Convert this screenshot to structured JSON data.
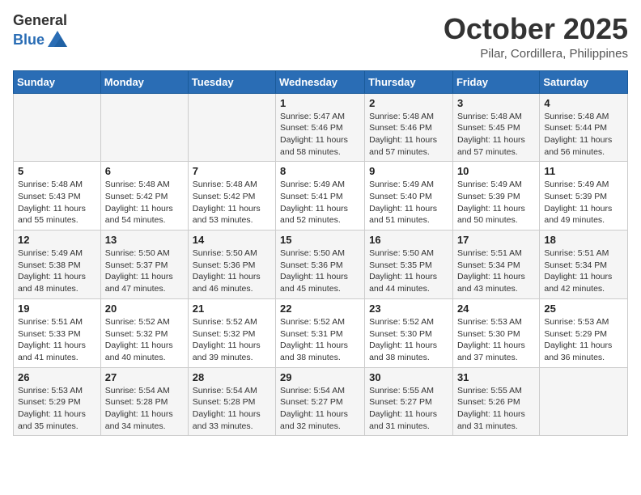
{
  "header": {
    "logo_general": "General",
    "logo_blue": "Blue",
    "month_title": "October 2025",
    "location": "Pilar, Cordillera, Philippines"
  },
  "weekdays": [
    "Sunday",
    "Monday",
    "Tuesday",
    "Wednesday",
    "Thursday",
    "Friday",
    "Saturday"
  ],
  "weeks": [
    [
      {
        "day": "",
        "info": ""
      },
      {
        "day": "",
        "info": ""
      },
      {
        "day": "",
        "info": ""
      },
      {
        "day": "1",
        "info": "Sunrise: 5:47 AM\nSunset: 5:46 PM\nDaylight: 11 hours\nand 58 minutes."
      },
      {
        "day": "2",
        "info": "Sunrise: 5:48 AM\nSunset: 5:46 PM\nDaylight: 11 hours\nand 57 minutes."
      },
      {
        "day": "3",
        "info": "Sunrise: 5:48 AM\nSunset: 5:45 PM\nDaylight: 11 hours\nand 57 minutes."
      },
      {
        "day": "4",
        "info": "Sunrise: 5:48 AM\nSunset: 5:44 PM\nDaylight: 11 hours\nand 56 minutes."
      }
    ],
    [
      {
        "day": "5",
        "info": "Sunrise: 5:48 AM\nSunset: 5:43 PM\nDaylight: 11 hours\nand 55 minutes."
      },
      {
        "day": "6",
        "info": "Sunrise: 5:48 AM\nSunset: 5:42 PM\nDaylight: 11 hours\nand 54 minutes."
      },
      {
        "day": "7",
        "info": "Sunrise: 5:48 AM\nSunset: 5:42 PM\nDaylight: 11 hours\nand 53 minutes."
      },
      {
        "day": "8",
        "info": "Sunrise: 5:49 AM\nSunset: 5:41 PM\nDaylight: 11 hours\nand 52 minutes."
      },
      {
        "day": "9",
        "info": "Sunrise: 5:49 AM\nSunset: 5:40 PM\nDaylight: 11 hours\nand 51 minutes."
      },
      {
        "day": "10",
        "info": "Sunrise: 5:49 AM\nSunset: 5:39 PM\nDaylight: 11 hours\nand 50 minutes."
      },
      {
        "day": "11",
        "info": "Sunrise: 5:49 AM\nSunset: 5:39 PM\nDaylight: 11 hours\nand 49 minutes."
      }
    ],
    [
      {
        "day": "12",
        "info": "Sunrise: 5:49 AM\nSunset: 5:38 PM\nDaylight: 11 hours\nand 48 minutes."
      },
      {
        "day": "13",
        "info": "Sunrise: 5:50 AM\nSunset: 5:37 PM\nDaylight: 11 hours\nand 47 minutes."
      },
      {
        "day": "14",
        "info": "Sunrise: 5:50 AM\nSunset: 5:36 PM\nDaylight: 11 hours\nand 46 minutes."
      },
      {
        "day": "15",
        "info": "Sunrise: 5:50 AM\nSunset: 5:36 PM\nDaylight: 11 hours\nand 45 minutes."
      },
      {
        "day": "16",
        "info": "Sunrise: 5:50 AM\nSunset: 5:35 PM\nDaylight: 11 hours\nand 44 minutes."
      },
      {
        "day": "17",
        "info": "Sunrise: 5:51 AM\nSunset: 5:34 PM\nDaylight: 11 hours\nand 43 minutes."
      },
      {
        "day": "18",
        "info": "Sunrise: 5:51 AM\nSunset: 5:34 PM\nDaylight: 11 hours\nand 42 minutes."
      }
    ],
    [
      {
        "day": "19",
        "info": "Sunrise: 5:51 AM\nSunset: 5:33 PM\nDaylight: 11 hours\nand 41 minutes."
      },
      {
        "day": "20",
        "info": "Sunrise: 5:52 AM\nSunset: 5:32 PM\nDaylight: 11 hours\nand 40 minutes."
      },
      {
        "day": "21",
        "info": "Sunrise: 5:52 AM\nSunset: 5:32 PM\nDaylight: 11 hours\nand 39 minutes."
      },
      {
        "day": "22",
        "info": "Sunrise: 5:52 AM\nSunset: 5:31 PM\nDaylight: 11 hours\nand 38 minutes."
      },
      {
        "day": "23",
        "info": "Sunrise: 5:52 AM\nSunset: 5:30 PM\nDaylight: 11 hours\nand 38 minutes."
      },
      {
        "day": "24",
        "info": "Sunrise: 5:53 AM\nSunset: 5:30 PM\nDaylight: 11 hours\nand 37 minutes."
      },
      {
        "day": "25",
        "info": "Sunrise: 5:53 AM\nSunset: 5:29 PM\nDaylight: 11 hours\nand 36 minutes."
      }
    ],
    [
      {
        "day": "26",
        "info": "Sunrise: 5:53 AM\nSunset: 5:29 PM\nDaylight: 11 hours\nand 35 minutes."
      },
      {
        "day": "27",
        "info": "Sunrise: 5:54 AM\nSunset: 5:28 PM\nDaylight: 11 hours\nand 34 minutes."
      },
      {
        "day": "28",
        "info": "Sunrise: 5:54 AM\nSunset: 5:28 PM\nDaylight: 11 hours\nand 33 minutes."
      },
      {
        "day": "29",
        "info": "Sunrise: 5:54 AM\nSunset: 5:27 PM\nDaylight: 11 hours\nand 32 minutes."
      },
      {
        "day": "30",
        "info": "Sunrise: 5:55 AM\nSunset: 5:27 PM\nDaylight: 11 hours\nand 31 minutes."
      },
      {
        "day": "31",
        "info": "Sunrise: 5:55 AM\nSunset: 5:26 PM\nDaylight: 11 hours\nand 31 minutes."
      },
      {
        "day": "",
        "info": ""
      }
    ]
  ]
}
